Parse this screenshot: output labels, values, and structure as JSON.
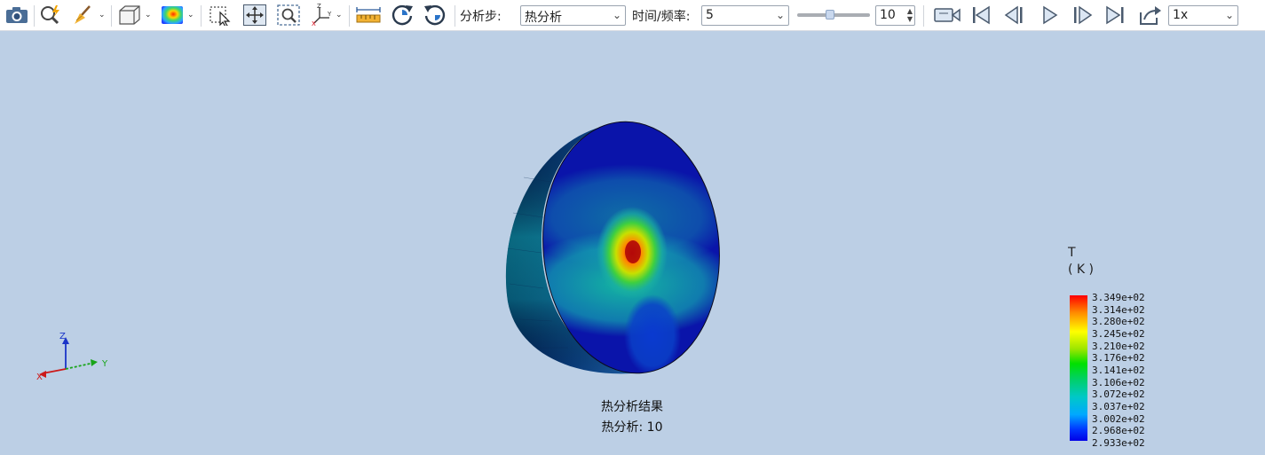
{
  "toolbar": {
    "icons": [
      "camera-icon",
      "zoom-select-icon",
      "broom-icon",
      "cube-icon",
      "contour-icon",
      "select-box-icon",
      "pan-icon",
      "zoom-box-icon",
      "axes-icon",
      "ruler-icon",
      "rotate-cw-icon",
      "rotate-ccw-icon",
      "record-icon",
      "first-frame-icon",
      "prev-frame-icon",
      "play-icon",
      "next-frame-icon",
      "last-frame-icon",
      "export-icon"
    ],
    "step_label": "分析步:",
    "step_value": "热分析",
    "time_label": "时间/频率:",
    "time_value": "5",
    "slider_fraction": 0.45,
    "frame_value": "10",
    "speed_value": "1x"
  },
  "viewport": {
    "background": "#bccfe5",
    "caption_title": "热分析结果",
    "caption_step": "热分析: 10",
    "triad": {
      "x": "X",
      "y": "Y",
      "z": "Z"
    }
  },
  "legend": {
    "variable": "T",
    "unit": "( K )",
    "values": [
      "3.349e+02",
      "3.314e+02",
      "3.280e+02",
      "3.245e+02",
      "3.210e+02",
      "3.176e+02",
      "3.141e+02",
      "3.106e+02",
      "3.072e+02",
      "3.037e+02",
      "3.002e+02",
      "2.968e+02",
      "2.933e+02"
    ]
  }
}
